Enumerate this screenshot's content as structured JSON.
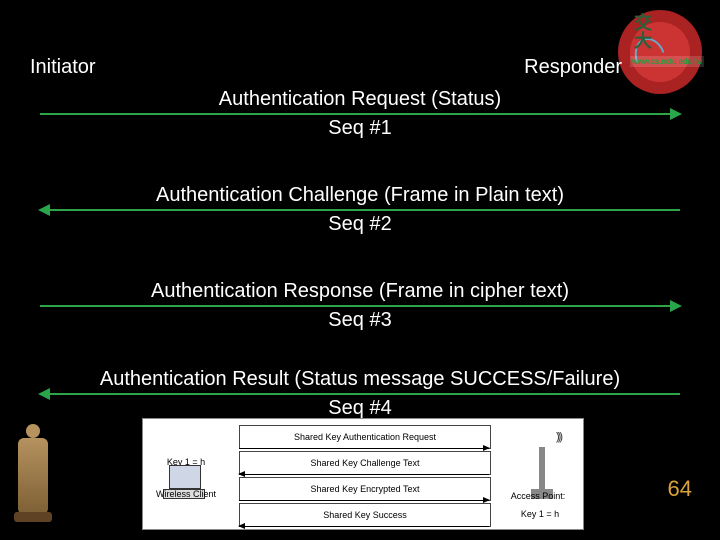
{
  "roles": {
    "left": "Initiator",
    "right": "Responder"
  },
  "messages": [
    {
      "label": "Authentication Request (Status)",
      "seq": "Seq #1",
      "dir": "r"
    },
    {
      "label": "Authentication Challenge (Frame in Plain text)",
      "seq": "Seq #2",
      "dir": "l"
    },
    {
      "label": "Authentication Response (Frame in cipher text)",
      "seq": "Seq #3",
      "dir": "r"
    },
    {
      "label": "Authentication Result (Status message SUCCESS/Failure)",
      "seq": "Seq #4",
      "dir": "l"
    }
  ],
  "inset": {
    "client_label": "Wireless Client",
    "ap_label": "Access Point:",
    "key1a": "Key 1 = h",
    "key1b": "Key 1 = h",
    "rows": [
      "Shared Key Authentication Request",
      "Shared Key Challenge Text",
      "Shared Key Encrypted Text",
      "Shared Key Success"
    ]
  },
  "logo": {
    "line1": "交",
    "line2": "大",
    "sub": "www.cs.nctu.edu.tw"
  },
  "page_number": "64"
}
